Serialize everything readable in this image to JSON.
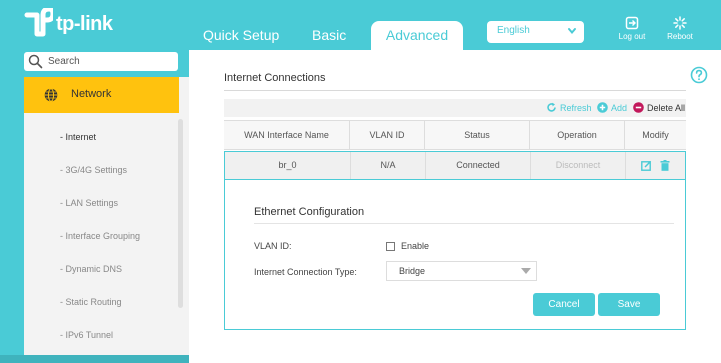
{
  "brand": {
    "name": "tp-link"
  },
  "nav": {
    "tabs": [
      {
        "label": "Quick Setup"
      },
      {
        "label": "Basic"
      },
      {
        "label": "Advanced",
        "active": true
      }
    ],
    "language": "English",
    "logout_label": "Log out",
    "reboot_label": "Reboot"
  },
  "sidebar": {
    "search_placeholder": "Search",
    "active_section": "Network",
    "items": [
      {
        "label": "- Internet",
        "active": true
      },
      {
        "label": "- 3G/4G Settings"
      },
      {
        "label": "- LAN Settings"
      },
      {
        "label": "- Interface Grouping"
      },
      {
        "label": "- Dynamic DNS"
      },
      {
        "label": "- Static Routing"
      },
      {
        "label": "- IPv6 Tunnel"
      }
    ]
  },
  "main": {
    "section_title": "Internet Connections",
    "toolbar": {
      "refresh": "Refresh",
      "add": "Add",
      "delete_all": "Delete All"
    },
    "table": {
      "columns": [
        "WAN Interface Name",
        "VLAN ID",
        "Status",
        "Operation",
        "Modify"
      ],
      "rows": [
        {
          "name": "br_0",
          "vlan": "N/A",
          "status": "Connected",
          "operation": "Disconnect"
        }
      ]
    },
    "config": {
      "title": "Ethernet Configuration",
      "vlan_label": "VLAN ID:",
      "enable_label": "Enable",
      "conn_type_label": "Internet Connection Type:",
      "conn_type_value": "Bridge",
      "cancel_label": "Cancel",
      "save_label": "Save"
    }
  },
  "colors": {
    "accent": "#4acbd6",
    "active_menu": "#ffc20e",
    "delete": "#c2185b"
  }
}
